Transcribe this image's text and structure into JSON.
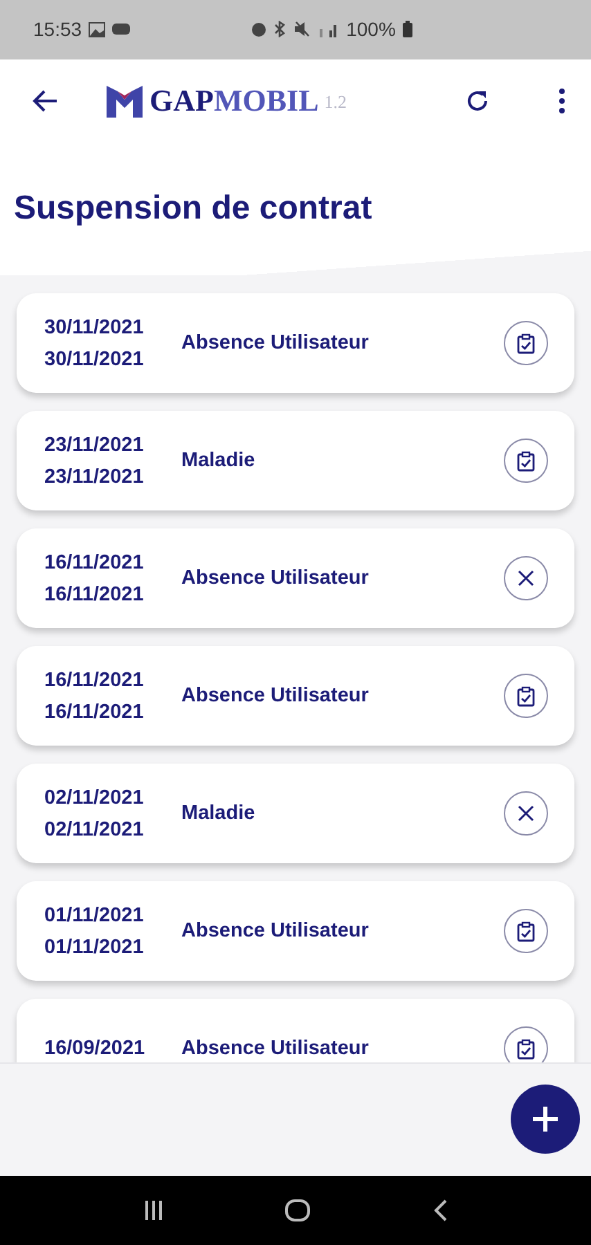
{
  "status_bar": {
    "time": "15:53",
    "battery": "100%"
  },
  "app_bar": {
    "brand": "GAP",
    "product": "MOBIL",
    "version": "1.2"
  },
  "title": "Suspension de contrat",
  "suspensions": [
    {
      "start": "30/11/2021",
      "end": "30/11/2021",
      "reason": "Absence Utilisateur",
      "validated": true
    },
    {
      "start": "23/11/2021",
      "end": "23/11/2021",
      "reason": "Maladie",
      "validated": true
    },
    {
      "start": "16/11/2021",
      "end": "16/11/2021",
      "reason": "Absence Utilisateur",
      "validated": false
    },
    {
      "start": "16/11/2021",
      "end": "16/11/2021",
      "reason": "Absence Utilisateur",
      "validated": true
    },
    {
      "start": "02/11/2021",
      "end": "02/11/2021",
      "reason": "Maladie",
      "validated": false
    },
    {
      "start": "01/11/2021",
      "end": "01/11/2021",
      "reason": "Absence Utilisateur",
      "validated": true
    },
    {
      "start": "16/09/2021",
      "reason": "Absence Utilisateur",
      "validated": true
    }
  ]
}
